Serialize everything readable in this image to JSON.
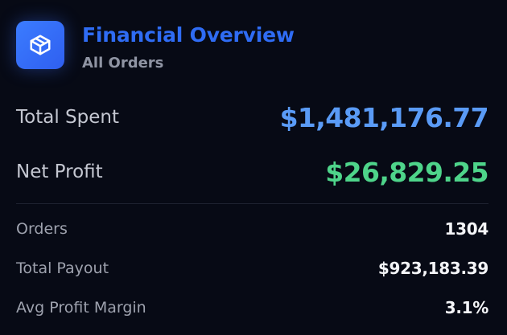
{
  "header": {
    "icon": "package-box-icon",
    "title": "Financial Overview",
    "subtitle": "All Orders"
  },
  "summary": {
    "total_spent": {
      "label": "Total Spent",
      "value": "$1,481,176.77",
      "color": "#5a9bf6"
    },
    "net_profit": {
      "label": "Net Profit",
      "value": "$26,829.25",
      "color": "#4ed48a"
    }
  },
  "details": {
    "orders": {
      "label": "Orders",
      "value": "1304"
    },
    "total_payout": {
      "label": "Total Payout",
      "value": "$923,183.39"
    },
    "avg_profit_margin": {
      "label": "Avg Profit Margin",
      "value": "3.1%"
    }
  },
  "colors": {
    "background": "#070a15",
    "accent": "#2f6cf4",
    "logo_background": "#3b7cff",
    "divider": "#1e2230"
  }
}
